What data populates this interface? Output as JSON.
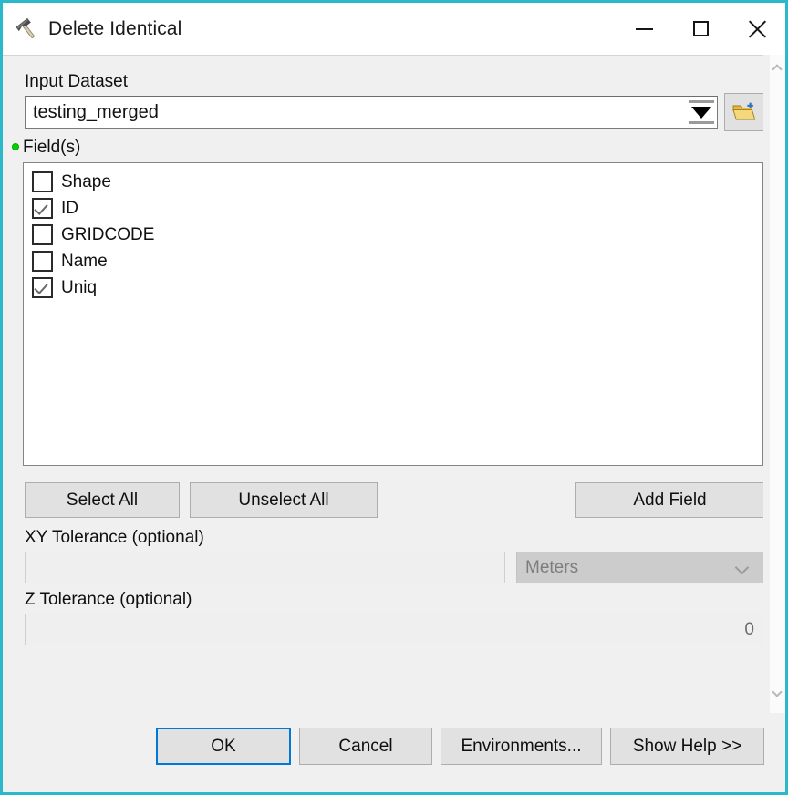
{
  "window": {
    "title": "Delete Identical",
    "icon": "hammer-icon",
    "border_color": "#2bb8c8",
    "minimize_label": "Minimize",
    "maximize_label": "Maximize",
    "close_label": "Close"
  },
  "form": {
    "input_dataset": {
      "label": "Input Dataset",
      "value": "testing_merged",
      "browse_icon": "open-folder-icon"
    },
    "fields": {
      "label": "Field(s)",
      "required_indicator_color": "#00d400",
      "items": [
        {
          "name": "Shape",
          "checked": false
        },
        {
          "name": "ID",
          "checked": true
        },
        {
          "name": "GRIDCODE",
          "checked": false
        },
        {
          "name": "Name",
          "checked": false
        },
        {
          "name": "Uniq",
          "checked": true
        }
      ]
    },
    "select_all_label": "Select All",
    "unselect_all_label": "Unselect All",
    "add_field_label": "Add Field",
    "xy_tolerance": {
      "label": "XY Tolerance (optional)",
      "value": "",
      "unit": "Meters",
      "disabled": true
    },
    "z_tolerance": {
      "label": "Z Tolerance (optional)",
      "value": "0",
      "disabled": true
    }
  },
  "footer": {
    "ok_label": "OK",
    "cancel_label": "Cancel",
    "environments_label": "Environments...",
    "show_help_label": "Show Help >>",
    "focus_color": "#0078d7"
  }
}
